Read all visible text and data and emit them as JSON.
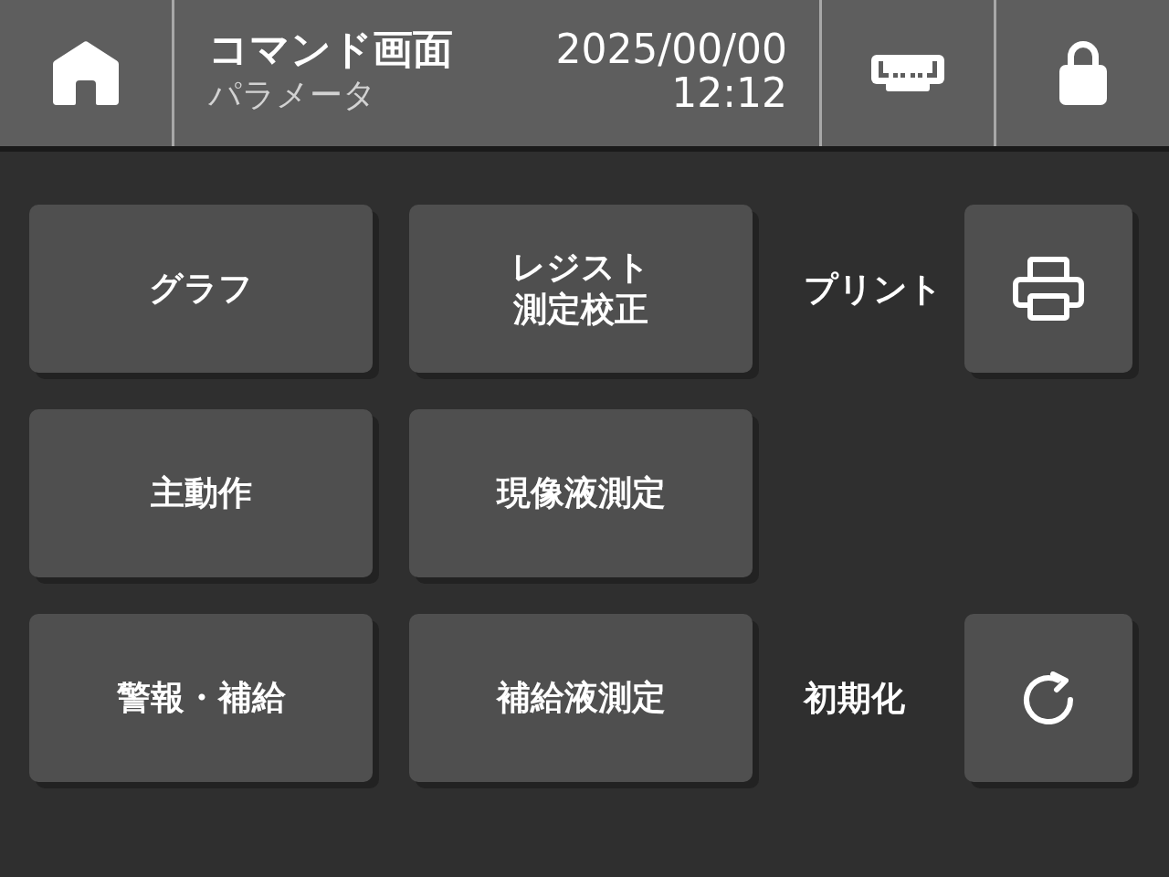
{
  "header": {
    "title": "コマンド画面",
    "subtitle": "パラメータ",
    "date": "2025/00/00",
    "time": "12:12"
  },
  "rows": [
    {
      "buttons": [
        {
          "label": "グラフ"
        },
        {
          "label": "レジスト測定校正"
        }
      ],
      "action": {
        "kind": "print",
        "label": "プリント"
      }
    },
    {
      "buttons": [
        {
          "label": "主動作"
        },
        {
          "label": "現像液測定"
        }
      ]
    },
    {
      "buttons": [
        {
          "label": "警報・補給"
        },
        {
          "label": "補給液測定"
        }
      ],
      "action": {
        "kind": "reset",
        "label": "初期化"
      }
    }
  ]
}
